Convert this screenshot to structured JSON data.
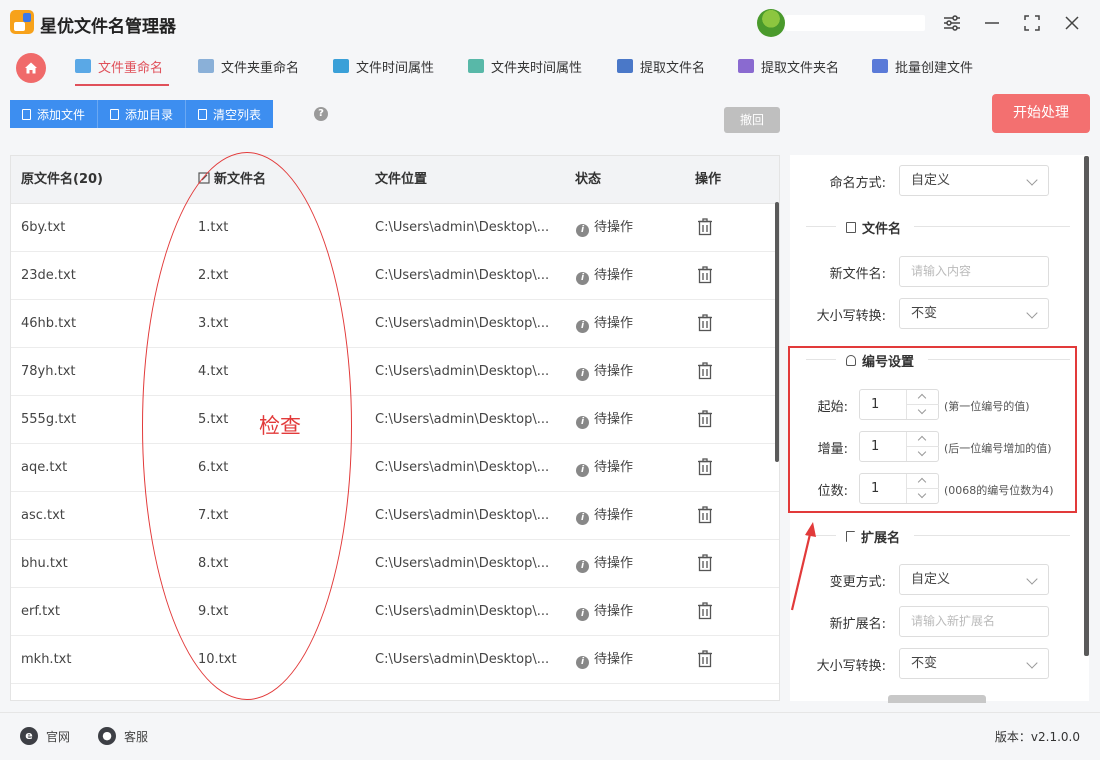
{
  "app": {
    "title": "星优文件名管理器"
  },
  "tabs": [
    {
      "label": "文件重命名",
      "active": true,
      "color": "#5aa8e6"
    },
    {
      "label": "文件夹重命名",
      "color": "#8ab0d8"
    },
    {
      "label": "文件时间属性",
      "color": "#3aa0d8"
    },
    {
      "label": "文件夹时间属性",
      "color": "#58b8a8"
    },
    {
      "label": "提取文件名",
      "color": "#4a78c8"
    },
    {
      "label": "提取文件夹名",
      "color": "#8a6ad0"
    },
    {
      "label": "批量创建文件",
      "color": "#5a7ad8"
    }
  ],
  "toolbar": {
    "add_file": "添加文件",
    "add_dir": "添加目录",
    "clear_list": "清空列表",
    "help": "?",
    "undo": "撤回",
    "start": "开始处理"
  },
  "table": {
    "headers": {
      "original": "原文件名(20)",
      "new_name": "新文件名",
      "location": "文件位置",
      "status": "状态",
      "action": "操作"
    },
    "rows": [
      {
        "original": "6by.txt",
        "new_name": "1.txt",
        "location": "C:\\Users\\admin\\Desktop\\...",
        "status": "待操作"
      },
      {
        "original": "23de.txt",
        "new_name": "2.txt",
        "location": "C:\\Users\\admin\\Desktop\\...",
        "status": "待操作"
      },
      {
        "original": "46hb.txt",
        "new_name": "3.txt",
        "location": "C:\\Users\\admin\\Desktop\\...",
        "status": "待操作"
      },
      {
        "original": "78yh.txt",
        "new_name": "4.txt",
        "location": "C:\\Users\\admin\\Desktop\\...",
        "status": "待操作"
      },
      {
        "original": "555g.txt",
        "new_name": "5.txt",
        "location": "C:\\Users\\admin\\Desktop\\...",
        "status": "待操作"
      },
      {
        "original": "aqe.txt",
        "new_name": "6.txt",
        "location": "C:\\Users\\admin\\Desktop\\...",
        "status": "待操作"
      },
      {
        "original": "asc.txt",
        "new_name": "7.txt",
        "location": "C:\\Users\\admin\\Desktop\\...",
        "status": "待操作"
      },
      {
        "original": "bhu.txt",
        "new_name": "8.txt",
        "location": "C:\\Users\\admin\\Desktop\\...",
        "status": "待操作"
      },
      {
        "original": "erf.txt",
        "new_name": "9.txt",
        "location": "C:\\Users\\admin\\Desktop\\...",
        "status": "待操作"
      },
      {
        "original": "mkh.txt",
        "new_name": "10.txt",
        "location": "C:\\Users\\admin\\Desktop\\...",
        "status": "待操作"
      }
    ]
  },
  "annotation": {
    "check_label": "检查",
    "color": "#e23a3a"
  },
  "settings": {
    "naming_mode_label": "命名方式:",
    "naming_mode_value": "自定义",
    "filename_section": "文件名",
    "new_name_label": "新文件名:",
    "new_name_placeholder": "请输入内容",
    "case_label": "大小写转换:",
    "case_value": "不变",
    "numbering_section": "编号设置",
    "start_label": "起始:",
    "start_value": "1",
    "start_hint": "(第一位编号的值)",
    "step_label": "增量:",
    "step_value": "1",
    "step_hint": "(后一位编号增加的值)",
    "digits_label": "位数:",
    "digits_value": "1",
    "digits_hint": "(0068的编号位数为4)",
    "ext_section": "扩展名",
    "ext_mode_label": "变更方式:",
    "ext_mode_value": "自定义",
    "new_ext_label": "新扩展名:",
    "new_ext_placeholder": "请输入新扩展名",
    "ext_case_label": "大小写转换:",
    "ext_case_value": "不变"
  },
  "footer": {
    "website": "官网",
    "service": "客服",
    "version": "版本：v2.1.0.0"
  },
  "colors": {
    "accent": "#3d8ef0",
    "start": "#f37070",
    "active_tab": "#e0505a"
  }
}
